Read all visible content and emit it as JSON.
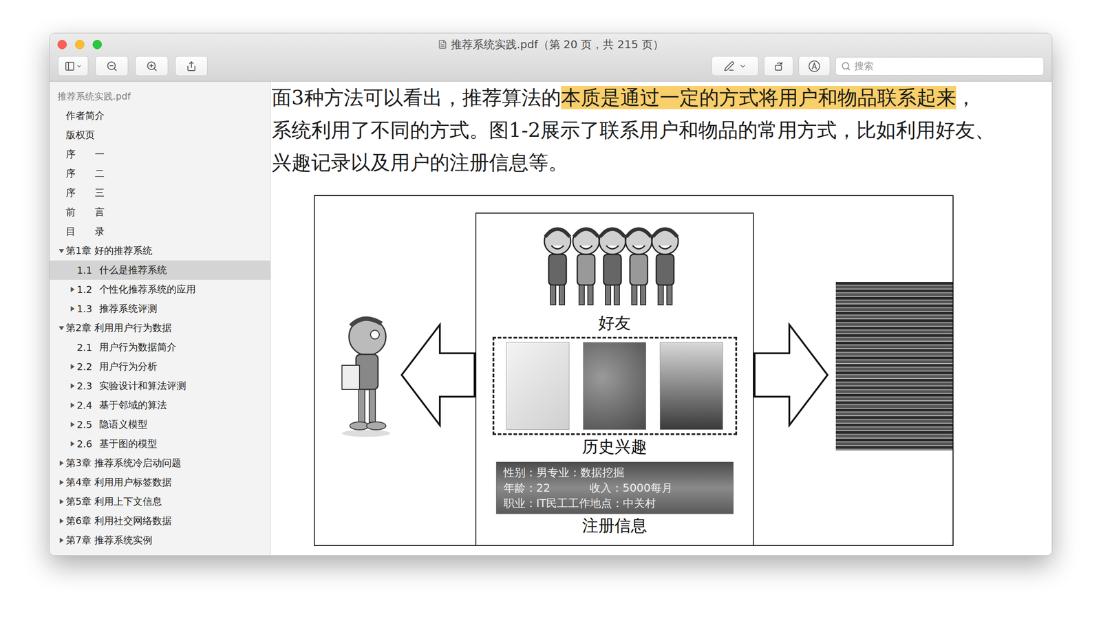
{
  "window": {
    "title": "推荐系统实践.pdf（第 20 页，共 215 页）"
  },
  "toolbar": {
    "search": {
      "placeholder": "搜索"
    }
  },
  "sidebar": {
    "header": "推荐系统实践.pdf",
    "items": [
      {
        "number": "",
        "label": "作者简介",
        "level": 1,
        "expandable": false,
        "expanded": false,
        "selected": false
      },
      {
        "number": "",
        "label": "版权页",
        "level": 1,
        "expandable": false,
        "expanded": false,
        "selected": false
      },
      {
        "number": "",
        "label": "序　　一",
        "level": 1,
        "expandable": false,
        "expanded": false,
        "selected": false
      },
      {
        "number": "",
        "label": "序　　二",
        "level": 1,
        "expandable": false,
        "expanded": false,
        "selected": false
      },
      {
        "number": "",
        "label": "序　　三",
        "level": 1,
        "expandable": false,
        "expanded": false,
        "selected": false
      },
      {
        "number": "",
        "label": "前　　言",
        "level": 1,
        "expandable": false,
        "expanded": false,
        "selected": false
      },
      {
        "number": "",
        "label": "目　　录",
        "level": 1,
        "expandable": false,
        "expanded": false,
        "selected": false
      },
      {
        "number": "",
        "label": "第1章 好的推荐系统",
        "level": 1,
        "expandable": true,
        "expanded": true,
        "selected": false
      },
      {
        "number": "1.1",
        "label": "什么是推荐系统",
        "level": 2,
        "expandable": false,
        "expanded": false,
        "selected": true
      },
      {
        "number": "1.2",
        "label": "个性化推荐系统的应用",
        "level": 2,
        "expandable": true,
        "expanded": false,
        "selected": false
      },
      {
        "number": "1.3",
        "label": "推荐系统评测",
        "level": 2,
        "expandable": true,
        "expanded": false,
        "selected": false
      },
      {
        "number": "",
        "label": "第2章 利用用户行为数据",
        "level": 1,
        "expandable": true,
        "expanded": true,
        "selected": false
      },
      {
        "number": "2.1",
        "label": "用户行为数据简介",
        "level": 2,
        "expandable": false,
        "expanded": false,
        "selected": false
      },
      {
        "number": "2.2",
        "label": "用户行为分析",
        "level": 2,
        "expandable": true,
        "expanded": false,
        "selected": false
      },
      {
        "number": "2.3",
        "label": "实验设计和算法评测",
        "level": 2,
        "expandable": true,
        "expanded": false,
        "selected": false
      },
      {
        "number": "2.4",
        "label": "基于邻域的算法",
        "level": 2,
        "expandable": true,
        "expanded": false,
        "selected": false
      },
      {
        "number": "2.5",
        "label": "隐语义模型",
        "level": 2,
        "expandable": true,
        "expanded": false,
        "selected": false
      },
      {
        "number": "2.6",
        "label": "基于图的模型",
        "level": 2,
        "expandable": true,
        "expanded": false,
        "selected": false
      },
      {
        "number": "",
        "label": "第3章 推荐系统冷启动问题",
        "level": 1,
        "expandable": true,
        "expanded": false,
        "selected": false
      },
      {
        "number": "",
        "label": "第4章 利用用户标签数据",
        "level": 1,
        "expandable": true,
        "expanded": false,
        "selected": false
      },
      {
        "number": "",
        "label": "第5章 利用上下文信息",
        "level": 1,
        "expandable": true,
        "expanded": false,
        "selected": false
      },
      {
        "number": "",
        "label": "第6章 利用社交网络数据",
        "level": 1,
        "expandable": true,
        "expanded": false,
        "selected": false
      },
      {
        "number": "",
        "label": "第7章 推荐系统实例",
        "level": 1,
        "expandable": true,
        "expanded": false,
        "selected": false
      }
    ]
  },
  "document": {
    "lines": [
      [
        {
          "text": "面3种方法可以看出，推荐算法的",
          "highlighted": false
        },
        {
          "text": "本质是通过一定的方式将用户和物品联系起来",
          "highlighted": true
        },
        {
          "text": "，",
          "highlighted": false
        }
      ],
      [
        {
          "text": "系统利用了不同的方式。图1-2展示了联系用户和物品的常用方式，比如利用好友、",
          "highlighted": false
        }
      ],
      [
        {
          "text": "兴趣记录以及用户的注册信息等。",
          "highlighted": false
        }
      ]
    ]
  },
  "figure": {
    "friends_label": "好友",
    "interests_label": "历史兴趣",
    "registration_label": "注册信息",
    "registration_lines": [
      [
        "性别：男专业：数据挖掘"
      ],
      [
        "年龄：22",
        "收入：5000每月"
      ],
      [
        "职业：IT民工工作地点：中关村"
      ]
    ]
  }
}
